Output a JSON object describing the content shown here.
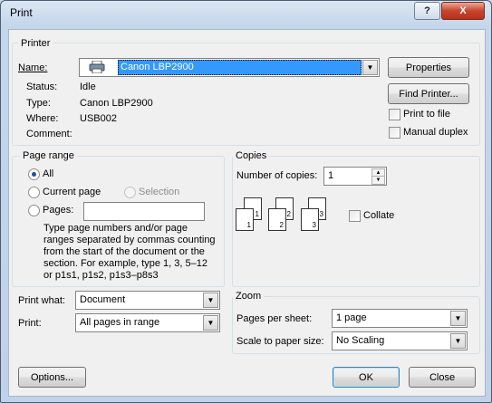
{
  "window": {
    "title": "Print",
    "help_glyph": "?",
    "close_glyph": "X"
  },
  "printer": {
    "group_label": "Printer",
    "name_label": "Name:",
    "name_value": "Canon LBP2900",
    "properties_label": "Properties",
    "status_label": "Status:",
    "status_value": "Idle",
    "type_label": "Type:",
    "type_value": "Canon LBP2900",
    "where_label": "Where:",
    "where_value": "USB002",
    "comment_label": "Comment:",
    "comment_value": "",
    "find_printer_label": "Find Printer...",
    "print_to_file_label": "Print to file",
    "print_to_file_checked": false,
    "manual_duplex_label": "Manual duplex",
    "manual_duplex_checked": false
  },
  "page_range": {
    "group_label": "Page range",
    "all_label": "All",
    "current_page_label": "Current page",
    "selection_label": "Selection",
    "pages_label": "Pages:",
    "pages_value": "",
    "selected": "All",
    "help_text": "Type page numbers and/or page ranges separated by commas counting from the start of the document or the section. For example, type 1, 3, 5–12 or p1s1, p1s2, p1s3–p8s3"
  },
  "copies": {
    "group_label": "Copies",
    "number_label": "Number of copies:",
    "number_value": "1",
    "collate_label": "Collate",
    "collate_checked": false,
    "page_numbers": [
      "1",
      "1",
      "2",
      "2",
      "3",
      "3"
    ]
  },
  "print_what": {
    "label": "Print what:",
    "value": "Document"
  },
  "print": {
    "label": "Print:",
    "value": "All pages in range"
  },
  "zoom": {
    "group_label": "Zoom",
    "pages_per_sheet_label": "Pages per sheet:",
    "pages_per_sheet_value": "1 page",
    "scale_label": "Scale to paper size:",
    "scale_value": "No Scaling"
  },
  "buttons": {
    "options": "Options...",
    "ok": "OK",
    "close": "Close"
  },
  "colors": {
    "accent": "#3399ff",
    "selection_text": "#ffffff"
  }
}
